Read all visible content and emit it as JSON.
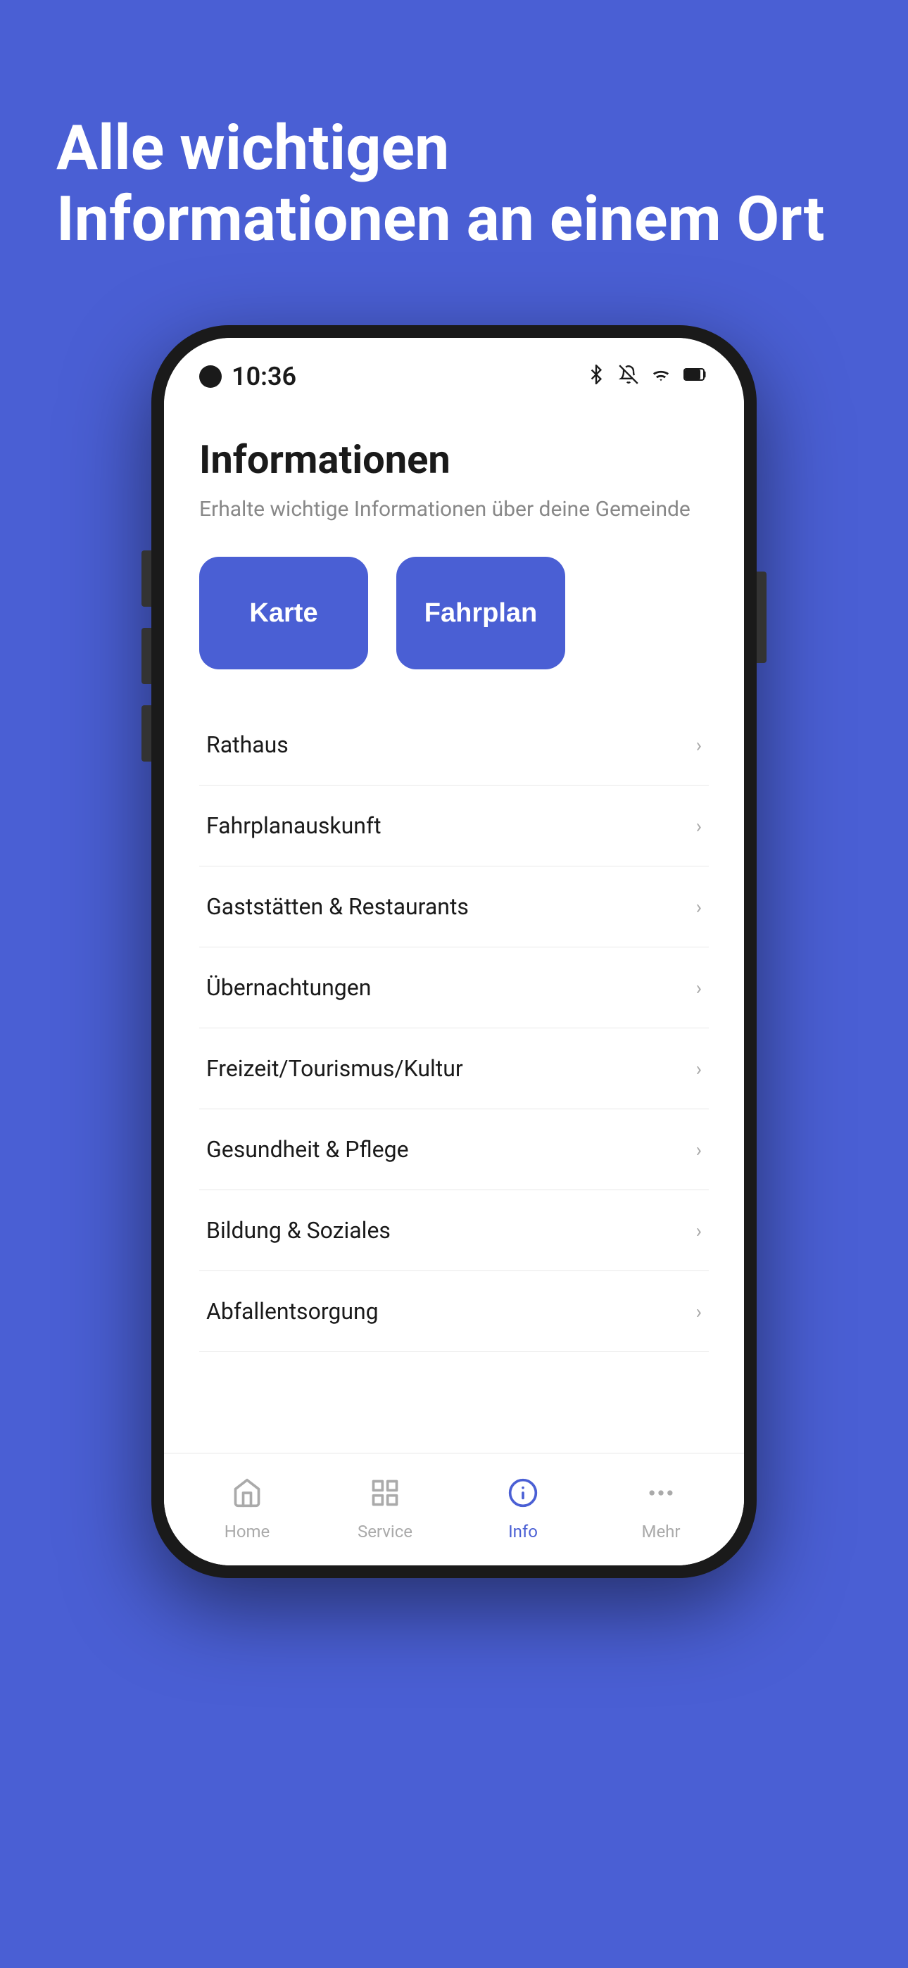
{
  "background_color": "#4a5fd4",
  "hero": {
    "title": "Alle wichtigen Informationen an einem Ort"
  },
  "phone": {
    "status_bar": {
      "time": "10:36",
      "icons": [
        "bluetooth",
        "bell-off",
        "wifi",
        "battery"
      ]
    },
    "app": {
      "page_title": "Informationen",
      "page_subtitle": "Erhalte wichtige Informationen über deine Gemeinde",
      "action_buttons": [
        {
          "label": "Karte"
        },
        {
          "label": "Fahrplan"
        }
      ],
      "menu_items": [
        {
          "label": "Rathaus"
        },
        {
          "label": "Fahrplanauskunft"
        },
        {
          "label": "Gaststätten & Restaurants"
        },
        {
          "label": "Übernachtungen"
        },
        {
          "label": "Freizeit/Tourismus/Kultur"
        },
        {
          "label": "Gesundheit & Pflege"
        },
        {
          "label": "Bildung & Soziales"
        },
        {
          "label": "Abfallentsorgung"
        }
      ]
    },
    "tab_bar": {
      "tabs": [
        {
          "label": "Home",
          "icon": "home",
          "active": false
        },
        {
          "label": "Service",
          "icon": "grid",
          "active": false
        },
        {
          "label": "Info",
          "icon": "info",
          "active": true
        },
        {
          "label": "Mehr",
          "icon": "more",
          "active": false
        }
      ]
    }
  }
}
